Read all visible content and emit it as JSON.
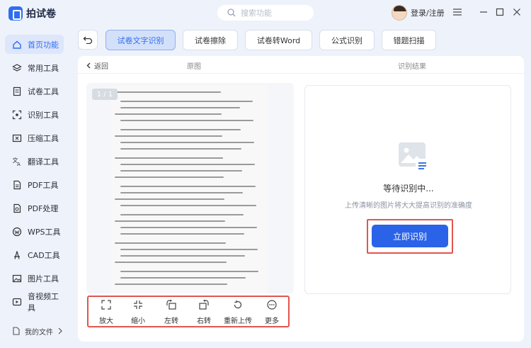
{
  "app": {
    "title": "拍试卷"
  },
  "search": {
    "placeholder": "搜索功能"
  },
  "user": {
    "login_label": "登录/注册"
  },
  "sidebar": {
    "items": [
      {
        "label": "首页功能",
        "icon": "home-icon",
        "active": true
      },
      {
        "label": "常用工具",
        "icon": "layers-icon"
      },
      {
        "label": "试卷工具",
        "icon": "paper-icon"
      },
      {
        "label": "识别工具",
        "icon": "scan-icon"
      },
      {
        "label": "压缩工具",
        "icon": "compress-icon"
      },
      {
        "label": "翻译工具",
        "icon": "translate-icon"
      },
      {
        "label": "PDF工具",
        "icon": "pdf-icon"
      },
      {
        "label": "PDF处理",
        "icon": "pdf-process-icon"
      },
      {
        "label": "WPS工具",
        "icon": "wps-icon"
      },
      {
        "label": "CAD工具",
        "icon": "cad-icon"
      },
      {
        "label": "图片工具",
        "icon": "image-icon"
      },
      {
        "label": "音视频工具",
        "icon": "video-icon"
      }
    ],
    "my_files": "我的文件"
  },
  "tabs": [
    {
      "label": "试卷文字识别",
      "active": true
    },
    {
      "label": "试卷擦除"
    },
    {
      "label": "试卷转Word"
    },
    {
      "label": "公式识别"
    },
    {
      "label": "错题扫描"
    }
  ],
  "subheader": {
    "back": "返回",
    "original": "原图",
    "result": "识别结果"
  },
  "preview": {
    "page_indicator": "1 / 1"
  },
  "tools": [
    {
      "label": "放大",
      "icon": "expand-icon"
    },
    {
      "label": "缩小",
      "icon": "shrink-icon"
    },
    {
      "label": "左转",
      "icon": "rotate-left-icon"
    },
    {
      "label": "右转",
      "icon": "rotate-right-icon"
    },
    {
      "label": "重新上传",
      "icon": "reupload-icon"
    },
    {
      "label": "更多",
      "icon": "more-icon"
    }
  ],
  "result": {
    "waiting": "等待识别中...",
    "hint": "上传清晰的图片将大大提高识别的准确度",
    "button": "立即识别"
  },
  "colors": {
    "accent": "#2a63e8",
    "highlight": "#e2554f",
    "background": "#eef2fb"
  }
}
